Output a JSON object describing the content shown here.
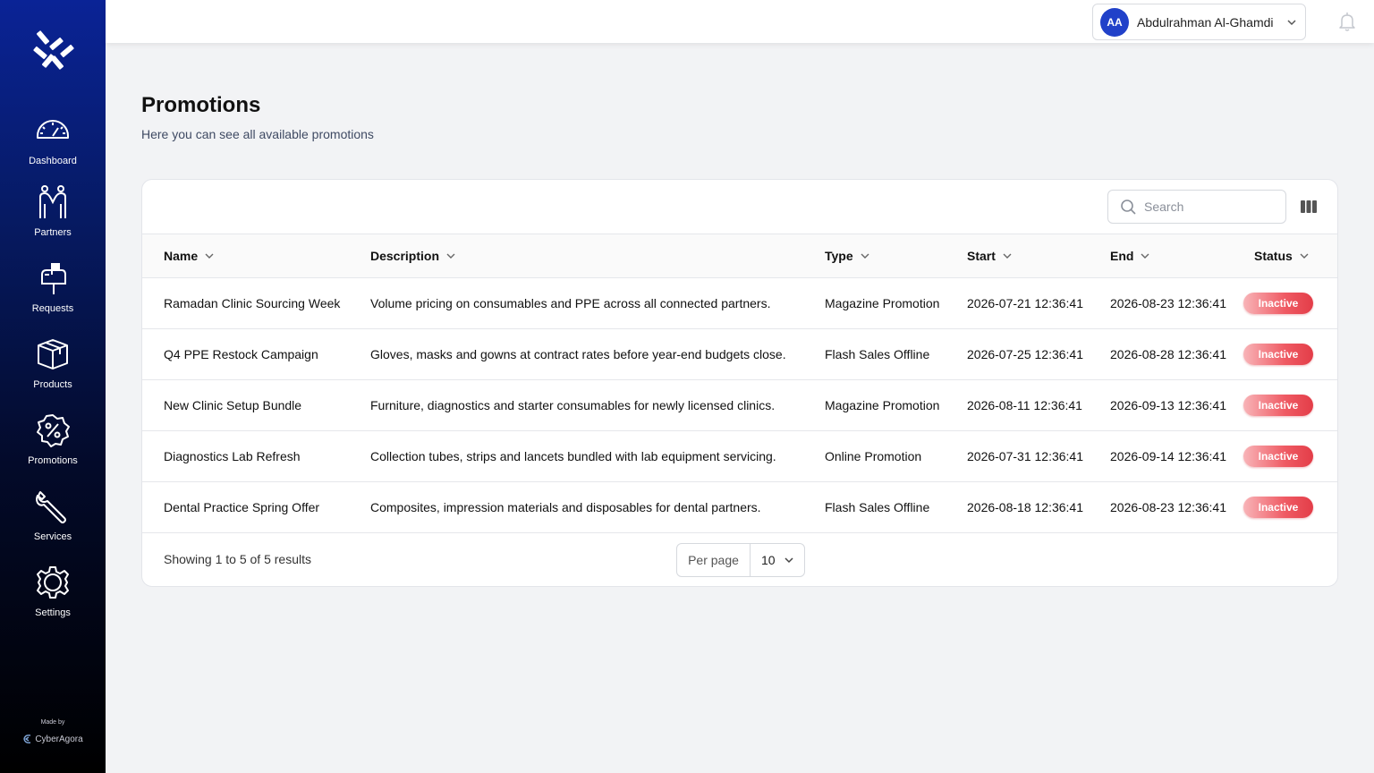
{
  "sidebar": {
    "items": [
      {
        "label": "Dashboard",
        "icon": "gauge-icon"
      },
      {
        "label": "Partners",
        "icon": "handshake-icon"
      },
      {
        "label": "Requests",
        "icon": "mailbox-icon"
      },
      {
        "label": "Products",
        "icon": "box-icon"
      },
      {
        "label": "Promotions",
        "icon": "percent-badge-icon"
      },
      {
        "label": "Services",
        "icon": "wrench-icon"
      },
      {
        "label": "Settings",
        "icon": "gear-icon"
      }
    ],
    "made_by": "Made by",
    "brand": "CyberAgora"
  },
  "topbar": {
    "avatar_initials": "AA",
    "user_name": "Abdulrahman Al-Ghamdi"
  },
  "page": {
    "title": "Promotions",
    "subtitle": "Here you can see all available promotions"
  },
  "search": {
    "placeholder": "Search"
  },
  "table": {
    "columns": [
      "Name",
      "Description",
      "Type",
      "Start",
      "End",
      "Status"
    ],
    "rows": [
      {
        "name": "Ramadan Clinic Sourcing Week",
        "description": "Volume pricing on consumables and PPE across all connected partners.",
        "type": "Magazine Promotion",
        "start": "2026-07-21 12:36:41",
        "end": "2026-08-23 12:36:41",
        "status": "Inactive"
      },
      {
        "name": "Q4 PPE Restock Campaign",
        "description": "Gloves, masks and gowns at contract rates before year-end budgets close.",
        "type": "Flash Sales Offline",
        "start": "2026-07-25 12:36:41",
        "end": "2026-08-28 12:36:41",
        "status": "Inactive"
      },
      {
        "name": "New Clinic Setup Bundle",
        "description": "Furniture, diagnostics and starter consumables for newly licensed clinics.",
        "type": "Magazine Promotion",
        "start": "2026-08-11 12:36:41",
        "end": "2026-09-13 12:36:41",
        "status": "Inactive"
      },
      {
        "name": "Diagnostics Lab Refresh",
        "description": "Collection tubes, strips and lancets bundled with lab equipment servicing.",
        "type": "Online Promotion",
        "start": "2026-07-31 12:36:41",
        "end": "2026-09-14 12:36:41",
        "status": "Inactive"
      },
      {
        "name": "Dental Practice Spring Offer",
        "description": "Composites, impression materials and disposables for dental partners.",
        "type": "Flash Sales Offline",
        "start": "2026-08-18 12:36:41",
        "end": "2026-08-23 12:36:41",
        "status": "Inactive"
      }
    ]
  },
  "footer": {
    "showing": "Showing 1 to 5 of 5 results",
    "per_page_label": "Per page",
    "per_page_value": "10"
  },
  "colors": {
    "accent": "#2141c9",
    "inactive_badge": "#ef5a63",
    "sidebar_top": "#0a2396"
  }
}
